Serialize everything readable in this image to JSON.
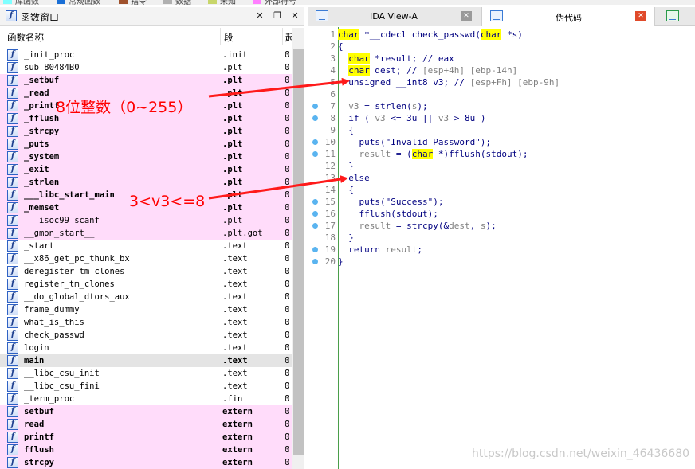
{
  "legend": {
    "items": [
      {
        "label": "库函数",
        "color": "#80ffff"
      },
      {
        "label": "常规函数",
        "color": "#1a6fd6"
      },
      {
        "label": "指令",
        "color": "#a0522d"
      },
      {
        "label": "数据",
        "color": "#b0b0b0"
      },
      {
        "label": "未知",
        "color": "#c8d66b"
      },
      {
        "label": "外部符号",
        "color": "#ff80ff"
      }
    ]
  },
  "functions_panel": {
    "title": "函数窗口",
    "columns": [
      "函数名称",
      "段",
      "起"
    ],
    "rows": [
      {
        "name": "_init_proc",
        "segment": ".init",
        "addr": "0",
        "style": "normal"
      },
      {
        "name": "sub_80484B0",
        "segment": ".plt",
        "addr": "0",
        "style": "normal"
      },
      {
        "name": "_setbuf",
        "segment": ".plt",
        "addr": "0",
        "style": "pink-bold"
      },
      {
        "name": "_read",
        "segment": ".plt",
        "addr": "0",
        "style": "pink-bold"
      },
      {
        "name": "_printf",
        "segment": ".plt",
        "addr": "0",
        "style": "pink-bold"
      },
      {
        "name": "_fflush",
        "segment": ".plt",
        "addr": "0",
        "style": "pink-bold"
      },
      {
        "name": "_strcpy",
        "segment": ".plt",
        "addr": "0",
        "style": "pink-bold"
      },
      {
        "name": "_puts",
        "segment": ".plt",
        "addr": "0",
        "style": "pink-bold"
      },
      {
        "name": "_system",
        "segment": ".plt",
        "addr": "0",
        "style": "pink-bold"
      },
      {
        "name": "_exit",
        "segment": ".plt",
        "addr": "0",
        "style": "pink-bold"
      },
      {
        "name": "_strlen",
        "segment": ".plt",
        "addr": "0",
        "style": "pink-bold"
      },
      {
        "name": "___libc_start_main",
        "segment": ".plt",
        "addr": "0",
        "style": "pink-bold"
      },
      {
        "name": "_memset",
        "segment": ".plt",
        "addr": "0",
        "style": "pink-bold"
      },
      {
        "name": "___isoc99_scanf",
        "segment": ".plt",
        "addr": "0",
        "style": "pink"
      },
      {
        "name": "__gmon_start__",
        "segment": ".plt.got",
        "addr": "0",
        "style": "pink"
      },
      {
        "name": "_start",
        "segment": ".text",
        "addr": "0",
        "style": "normal"
      },
      {
        "name": "__x86_get_pc_thunk_bx",
        "segment": ".text",
        "addr": "0",
        "style": "normal"
      },
      {
        "name": "deregister_tm_clones",
        "segment": ".text",
        "addr": "0",
        "style": "normal"
      },
      {
        "name": "register_tm_clones",
        "segment": ".text",
        "addr": "0",
        "style": "normal"
      },
      {
        "name": "__do_global_dtors_aux",
        "segment": ".text",
        "addr": "0",
        "style": "normal"
      },
      {
        "name": "frame_dummy",
        "segment": ".text",
        "addr": "0",
        "style": "normal"
      },
      {
        "name": "what_is_this",
        "segment": ".text",
        "addr": "0",
        "style": "normal"
      },
      {
        "name": "check_passwd",
        "segment": ".text",
        "addr": "0",
        "style": "normal"
      },
      {
        "name": "login",
        "segment": ".text",
        "addr": "0",
        "style": "normal"
      },
      {
        "name": "main",
        "segment": ".text",
        "addr": "0",
        "style": "selected-bold"
      },
      {
        "name": "__libc_csu_init",
        "segment": ".text",
        "addr": "0",
        "style": "normal"
      },
      {
        "name": "__libc_csu_fini",
        "segment": ".text",
        "addr": "0",
        "style": "normal"
      },
      {
        "name": "_term_proc",
        "segment": ".fini",
        "addr": "0",
        "style": "normal"
      },
      {
        "name": "setbuf",
        "segment": "extern",
        "addr": "0",
        "style": "pink-bold"
      },
      {
        "name": "read",
        "segment": "extern",
        "addr": "0",
        "style": "pink-bold"
      },
      {
        "name": "printf",
        "segment": "extern",
        "addr": "0",
        "style": "pink-bold"
      },
      {
        "name": "fflush",
        "segment": "extern",
        "addr": "0",
        "style": "pink-bold"
      },
      {
        "name": "strcpy",
        "segment": "extern",
        "addr": "0",
        "style": "pink-bold"
      }
    ]
  },
  "tabs": [
    {
      "label": "IDA View-A",
      "active": false
    },
    {
      "label": "伪代码",
      "active": true
    }
  ],
  "pseudocode": {
    "lines": [
      {
        "n": "1",
        "bp": false,
        "segs": [
          [
            "kw",
            "char"
          ],
          [
            "t",
            " *__cdecl check_passwd("
          ],
          [
            "kw",
            "char"
          ],
          [
            "t",
            " *s)"
          ]
        ]
      },
      {
        "n": "2",
        "bp": false,
        "segs": [
          [
            "t",
            "{"
          ]
        ]
      },
      {
        "n": "3",
        "bp": false,
        "segs": [
          [
            "t",
            "  "
          ],
          [
            "kw",
            "char"
          ],
          [
            "t",
            " *result; "
          ],
          [
            "t",
            "// eax"
          ]
        ]
      },
      {
        "n": "4",
        "bp": false,
        "segs": [
          [
            "t",
            "  "
          ],
          [
            "kw",
            "char"
          ],
          [
            "t",
            " dest; // "
          ],
          [
            "g",
            "[esp+4h] [ebp-14h]"
          ]
        ]
      },
      {
        "n": "5",
        "bp": false,
        "segs": [
          [
            "t",
            "  unsigned __int8 v3; // "
          ],
          [
            "g",
            "[esp+Fh] [ebp-9h]"
          ]
        ]
      },
      {
        "n": "6",
        "bp": false,
        "segs": [
          [
            "t",
            ""
          ]
        ]
      },
      {
        "n": "7",
        "bp": true,
        "segs": [
          [
            "g",
            "  v3"
          ],
          [
            "t",
            " = strlen("
          ],
          [
            "g",
            "s"
          ],
          [
            "t",
            ");"
          ]
        ]
      },
      {
        "n": "8",
        "bp": true,
        "segs": [
          [
            "t",
            "  if ( "
          ],
          [
            "g",
            "v3"
          ],
          [
            "t",
            " <= 3u || "
          ],
          [
            "g",
            "v3"
          ],
          [
            "t",
            " > 8u )"
          ]
        ]
      },
      {
        "n": "9",
        "bp": false,
        "segs": [
          [
            "t",
            "  {"
          ]
        ]
      },
      {
        "n": "10",
        "bp": true,
        "segs": [
          [
            "t",
            "    puts(\"Invalid Password\");"
          ]
        ]
      },
      {
        "n": "11",
        "bp": true,
        "segs": [
          [
            "g",
            "    result"
          ],
          [
            "t",
            " = ("
          ],
          [
            "kw",
            "char"
          ],
          [
            "t",
            " *)fflush(stdout);"
          ]
        ]
      },
      {
        "n": "12",
        "bp": false,
        "segs": [
          [
            "t",
            "  }"
          ]
        ]
      },
      {
        "n": "13",
        "bp": false,
        "segs": [
          [
            "t",
            "  else"
          ]
        ]
      },
      {
        "n": "14",
        "bp": false,
        "segs": [
          [
            "t",
            "  {"
          ]
        ]
      },
      {
        "n": "15",
        "bp": true,
        "segs": [
          [
            "t",
            "    puts(\"Success\");"
          ]
        ]
      },
      {
        "n": "16",
        "bp": true,
        "segs": [
          [
            "t",
            "    fflush(stdout);"
          ]
        ]
      },
      {
        "n": "17",
        "bp": true,
        "segs": [
          [
            "g",
            "    result"
          ],
          [
            "t",
            " = strcpy(&"
          ],
          [
            "g",
            "dest"
          ],
          [
            "t",
            ", "
          ],
          [
            "g",
            "s"
          ],
          [
            "t",
            ");"
          ]
        ]
      },
      {
        "n": "18",
        "bp": false,
        "segs": [
          [
            "t",
            "  }"
          ]
        ]
      },
      {
        "n": "19",
        "bp": true,
        "segs": [
          [
            "t",
            "  return "
          ],
          [
            "g",
            "result"
          ],
          [
            "t",
            ";"
          ]
        ]
      },
      {
        "n": "20",
        "bp": true,
        "segs": [
          [
            "t",
            "}"
          ]
        ]
      }
    ]
  },
  "annotations": {
    "a1": "8位整数（0~255）",
    "a2": "3<v3<=8",
    "color": "#ff0000"
  },
  "watermark": "https://blog.csdn.net/weixin_46436680",
  "colors": {
    "pink_row": "#ffdcfa",
    "keyword_highlight": "#ffff00",
    "code_text": "#000080",
    "comment_gray": "#808080",
    "breakpoint_dot": "#5ab4f0"
  }
}
